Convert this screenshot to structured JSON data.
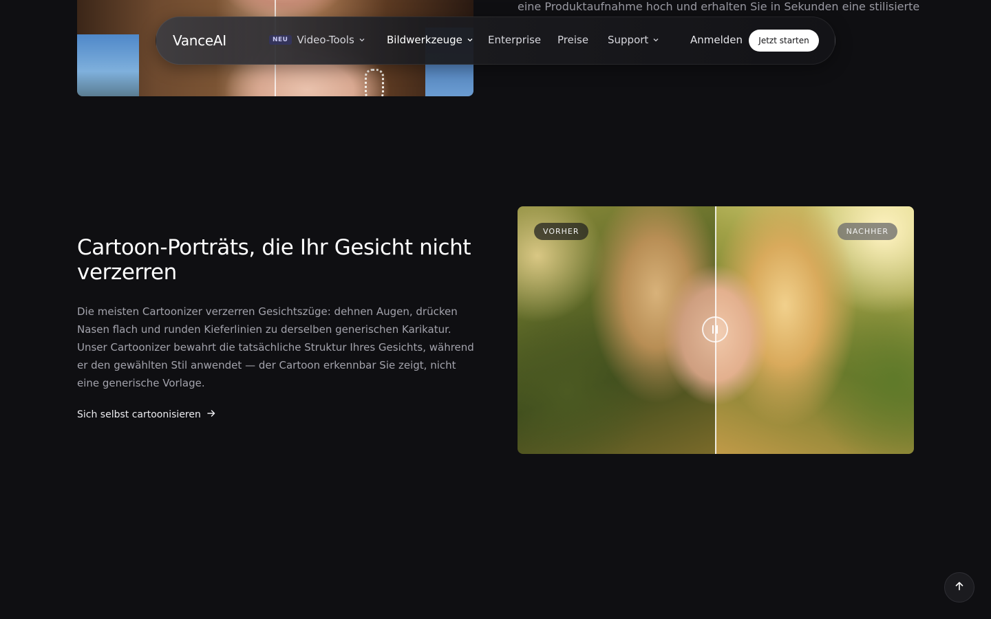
{
  "nav": {
    "logo": "VanceAI",
    "badge_new": "NEU",
    "items": [
      {
        "label": "Video-Tools",
        "has_dropdown": true
      },
      {
        "label": "Bildwerkzeuge",
        "has_dropdown": true
      },
      {
        "label": "Enterprise",
        "has_dropdown": false
      },
      {
        "label": "Preise",
        "has_dropdown": false
      },
      {
        "label": "Support",
        "has_dropdown": true
      }
    ],
    "login": "Anmelden",
    "cta": "Jetzt starten"
  },
  "previous_section": {
    "text": "eine Produktaufnahme hoch und erhalten Sie in Sekunden eine stilisierte"
  },
  "section": {
    "headline": "Cartoon-Porträts, die Ihr Gesicht nicht verzerren",
    "description": "Die meisten Cartoonizer verzerren Gesichtszüge: dehnen Augen, drücken Nasen flach und runden Kieferlinien zu derselben generischen Karikatur. Unser Cartoonizer bewahrt die tatsächliche Struktur Ihres Gesichts, während er den gewählten Stil anwendet — der Cartoon erkennbar Sie zeigt, nicht eine generische Vorlage.",
    "cta_link": "Sich selbst cartoonisieren"
  },
  "comparison": {
    "before_label": "VORHER",
    "after_label": "NACHHER",
    "split_fraction": 0.5
  },
  "icons": {
    "dropdown": "chevron-down-icon",
    "arrow": "arrow-right-icon",
    "scroll_top": "arrow-up-icon",
    "handle": "pause-icon"
  },
  "colors": {
    "background": "#0f0f12",
    "cta_background": "#ffffff",
    "badge_background": "#34345a"
  }
}
